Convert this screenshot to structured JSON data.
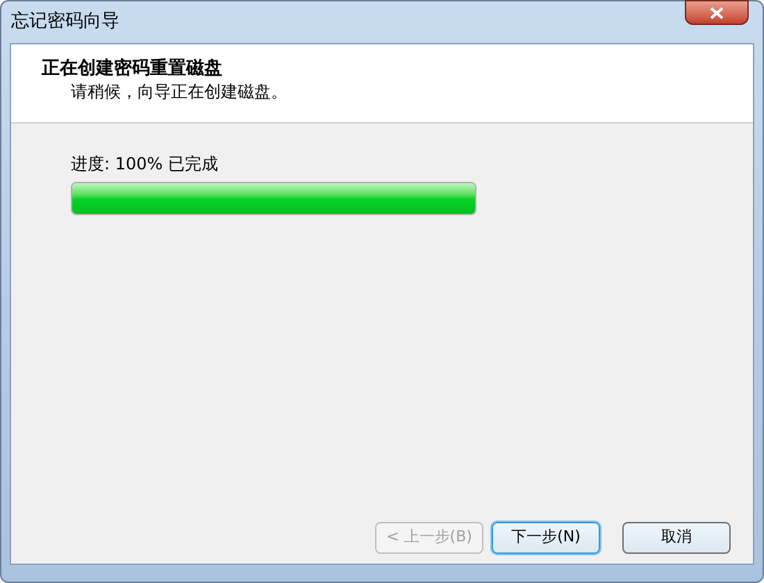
{
  "window": {
    "title": "忘记密码向导"
  },
  "header": {
    "title": "正在创建密码重置磁盘",
    "subtitle": "请稍候，向导正在创建磁盘。"
  },
  "progress": {
    "label": "进度: 100% 已完成",
    "level": 1
  },
  "buttons": [
    {
      "label": "< 上一步(B)",
      "disabled": true,
      "focused": false
    },
    {
      "label": "下一步(N)",
      "disabled": false,
      "focused": true
    },
    {
      "label": "取消",
      "disabled": false,
      "focused": false
    }
  ]
}
